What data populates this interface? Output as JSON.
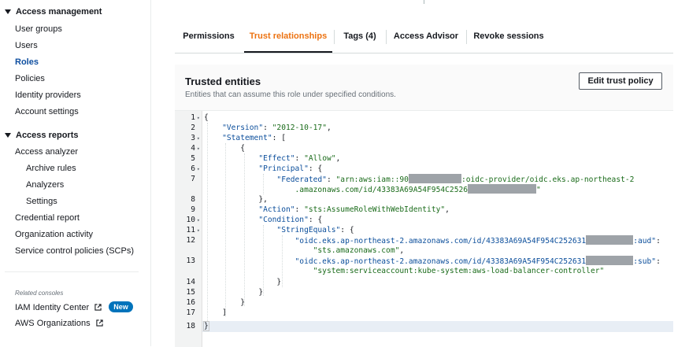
{
  "sidebar": {
    "access_management": {
      "header": "Access management",
      "items": [
        "User groups",
        "Users",
        "Roles",
        "Policies",
        "Identity providers",
        "Account settings"
      ]
    },
    "access_reports": {
      "header": "Access reports",
      "items": [
        "Access analyzer",
        "Archive rules",
        "Analyzers",
        "Settings",
        "Credential report",
        "Organization activity",
        "Service control policies (SCPs)"
      ]
    },
    "related_label": "Related consoles",
    "related": [
      "IAM Identity Center",
      "AWS Organizations"
    ],
    "new_badge": "New"
  },
  "tabs": [
    "Permissions",
    "Trust relationships",
    "Tags (4)",
    "Access Advisor",
    "Revoke sessions"
  ],
  "panel": {
    "title": "Trusted entities",
    "description": "Entities that can assume this role under specified conditions.",
    "edit_button": "Edit trust policy"
  },
  "code": {
    "line_numbers": [
      "1",
      "2",
      "3",
      "4",
      "5",
      "6",
      "7",
      "8",
      "9",
      "10",
      "11",
      "12",
      "13",
      "14",
      "15",
      "16",
      "17",
      "18"
    ],
    "t_open": "{",
    "version_key": "\"Version\"",
    "version_val": "\"2012-10-17\"",
    "statement_key": "\"Statement\"",
    "open_bracket": "[",
    "open_brace": "{",
    "effect_key": "\"Effect\"",
    "effect_val": "\"Allow\"",
    "principal_key": "\"Principal\"",
    "federated_key": "\"Federated\"",
    "fed_val_a": "\"arn:aws:iam::90",
    "fed_val_b": ":oidc-provider/oidc.eks.ap-northeast-2",
    "fed_val_c": ".amazonaws.com/id/43383A69A54F954C2526",
    "fed_val_d": "\"",
    "close_brace_comma": "},",
    "action_key": "\"Action\"",
    "action_val": "\"sts:AssumeRoleWithWebIdentity\"",
    "condition_key": "\"Condition\"",
    "stringequals_key": "\"StringEquals\"",
    "aud_key_a": "\"oidc.eks.ap-northeast-2.amazonaws.com/id/43383A69A54F954C252631",
    "aud_key_b": ":aud\"",
    "aud_val": "\"sts.amazonaws.com\"",
    "sub_key_a": "\"oidc.eks.ap-northeast-2.amazonaws.com/id/43383A69A54F954C252631",
    "sub_key_b": ":sub\"",
    "sub_val": "\"system:serviceaccount:kube-system:aws-load-balancer-controller\"",
    "close_brace": "}",
    "close_bracket": "]",
    "t_close": "}"
  }
}
